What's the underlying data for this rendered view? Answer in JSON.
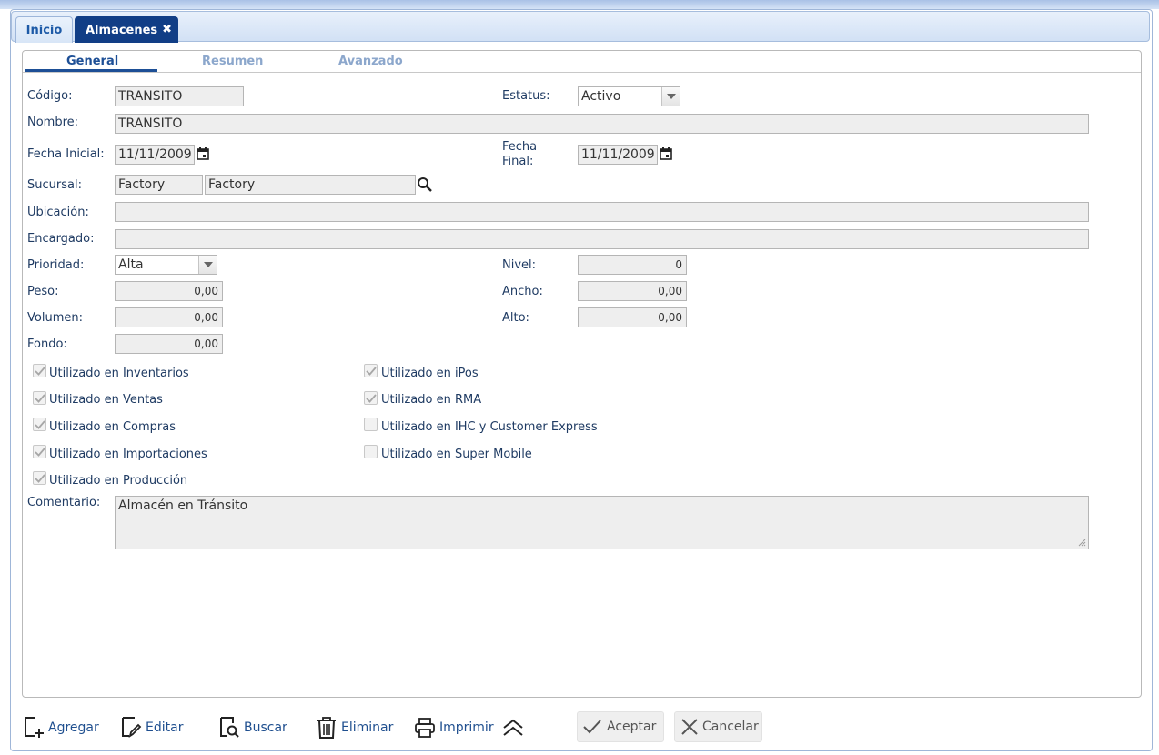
{
  "tabs": [
    {
      "label": "Inicio",
      "active": false
    },
    {
      "label": "Almacenes",
      "active": true
    }
  ],
  "subtabs": [
    "General",
    "Resumen",
    "Avanzado"
  ],
  "form": {
    "codigo": {
      "label": "Código:",
      "value": "TRANSITO"
    },
    "estatus": {
      "label": "Estatus:",
      "value": "Activo"
    },
    "nombre": {
      "label": "Nombre:",
      "value": "TRANSITO"
    },
    "fecha_inicial": {
      "label": "Fecha Inicial:",
      "value": "11/11/2009"
    },
    "fecha_final": {
      "label_line1": "Fecha",
      "label_line2": "Final:",
      "value": "11/11/2009"
    },
    "sucursal": {
      "label": "Sucursal:",
      "code": "Factory",
      "name": "Factory"
    },
    "ubicacion": {
      "label": "Ubicación:",
      "value": ""
    },
    "encargado": {
      "label": "Encargado:",
      "value": ""
    },
    "prioridad": {
      "label": "Prioridad:",
      "value": "Alta"
    },
    "nivel": {
      "label": "Nivel:",
      "value": "0"
    },
    "peso": {
      "label": "Peso:",
      "value": "0,00"
    },
    "ancho": {
      "label": "Ancho:",
      "value": "0,00"
    },
    "volumen": {
      "label": "Volumen:",
      "value": "0,00"
    },
    "alto": {
      "label": "Alto:",
      "value": "0,00"
    },
    "fondo": {
      "label": "Fondo:",
      "value": "0,00"
    },
    "comentario": {
      "label": "Comentario:",
      "value": "Almacén en Tránsito"
    }
  },
  "checkboxes_left": [
    {
      "label": "Utilizado en Inventarios",
      "checked": true
    },
    {
      "label": "Utilizado en Ventas",
      "checked": true
    },
    {
      "label": "Utilizado en Compras",
      "checked": true
    },
    {
      "label": "Utilizado en Importaciones",
      "checked": true
    },
    {
      "label": "Utilizado en Producción",
      "checked": true
    }
  ],
  "checkboxes_right": [
    {
      "label": "Utilizado en iPos",
      "checked": true
    },
    {
      "label": "Utilizado en RMA",
      "checked": true
    },
    {
      "label": "Utilizado en IHC y Customer Express",
      "checked": false
    },
    {
      "label": "Utilizado en Super Mobile",
      "checked": false
    }
  ],
  "toolbar": {
    "agregar": "Agregar",
    "editar": "Editar",
    "buscar": "Buscar",
    "eliminar": "Eliminar",
    "imprimir": "Imprimir",
    "aceptar": "Aceptar",
    "cancelar": "Cancelar"
  },
  "colors": {
    "accent": "#113e86",
    "label_text": "#1f3b63",
    "field_bg": "#eeeeee",
    "tab_inactive_text": "#8ca7cc"
  }
}
